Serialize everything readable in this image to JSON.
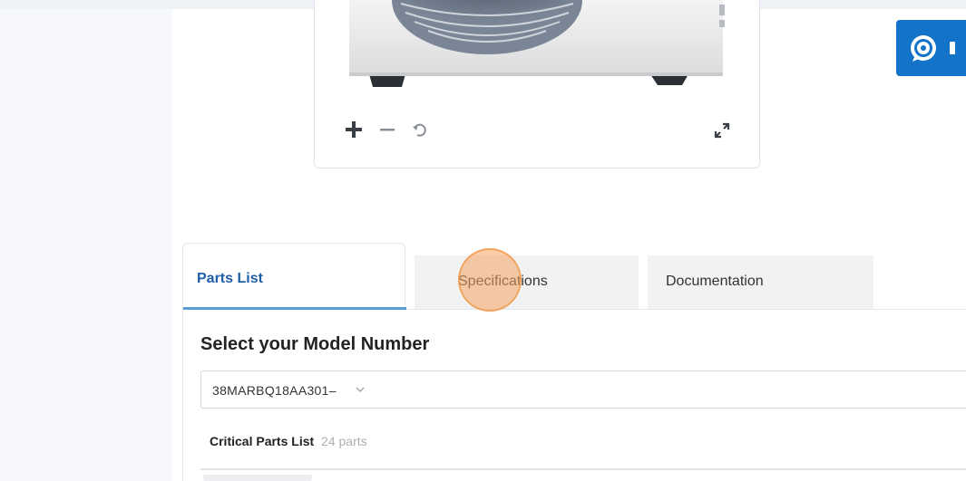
{
  "tabs": [
    {
      "label": "Parts List",
      "active": true
    },
    {
      "label": "Specifications",
      "active": false
    },
    {
      "label": "Documentation",
      "active": false
    }
  ],
  "section_title": "Select your Model Number",
  "model_select": {
    "value": "38MARBQ18AA301–"
  },
  "parts_list": {
    "title": "Critical Parts List",
    "count": "24 parts"
  },
  "image_viewer": {
    "controls": [
      "plus-icon",
      "minus-icon",
      "rotate-icon",
      "expand-icon"
    ]
  },
  "chat_button": {
    "icon": "chat-bubble-icon"
  },
  "colors": {
    "accent": "#1273c9",
    "active_tab_text": "#1f5fa8",
    "tab_underline": "#5b9bd5",
    "click_highlight": "#f4a460"
  }
}
